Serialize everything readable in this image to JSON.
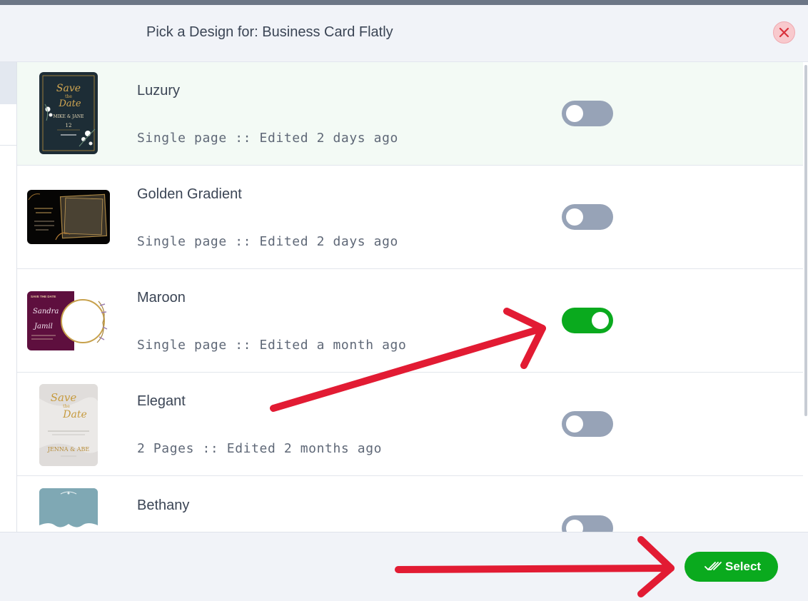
{
  "dialog": {
    "title": "Pick a Design for: Business Card Flatly",
    "close_icon": "close-icon",
    "close_color": "#d9313c"
  },
  "designs": [
    {
      "name": "Luzury",
      "meta": "Single page :: Edited 2 days ago",
      "selected": false,
      "thumb_text": [
        "Save",
        "the",
        "Date",
        "MIKE & JANE",
        "12"
      ]
    },
    {
      "name": "Golden Gradient",
      "meta": "Single page :: Edited 2 days ago",
      "selected": false
    },
    {
      "name": "Maroon",
      "meta": "Single page :: Edited a month ago",
      "selected": true,
      "thumb_text": [
        "SAVE THE DATE",
        "Sandra",
        "Jamil"
      ]
    },
    {
      "name": "Elegant",
      "meta": "2 Pages :: Edited 2 months ago",
      "selected": false,
      "thumb_text": [
        "Save",
        "the",
        "Date",
        "JENNA & ABE"
      ]
    },
    {
      "name": "Bethany",
      "meta": "",
      "selected": false
    }
  ],
  "footer": {
    "select_label": "Select",
    "select_icon": "double-check-icon"
  },
  "colors": {
    "accent_green": "#0aaa1e",
    "toggle_off": "#97a3b7",
    "annotation_red": "#e21b33",
    "header_bg": "#f1f3f8"
  }
}
